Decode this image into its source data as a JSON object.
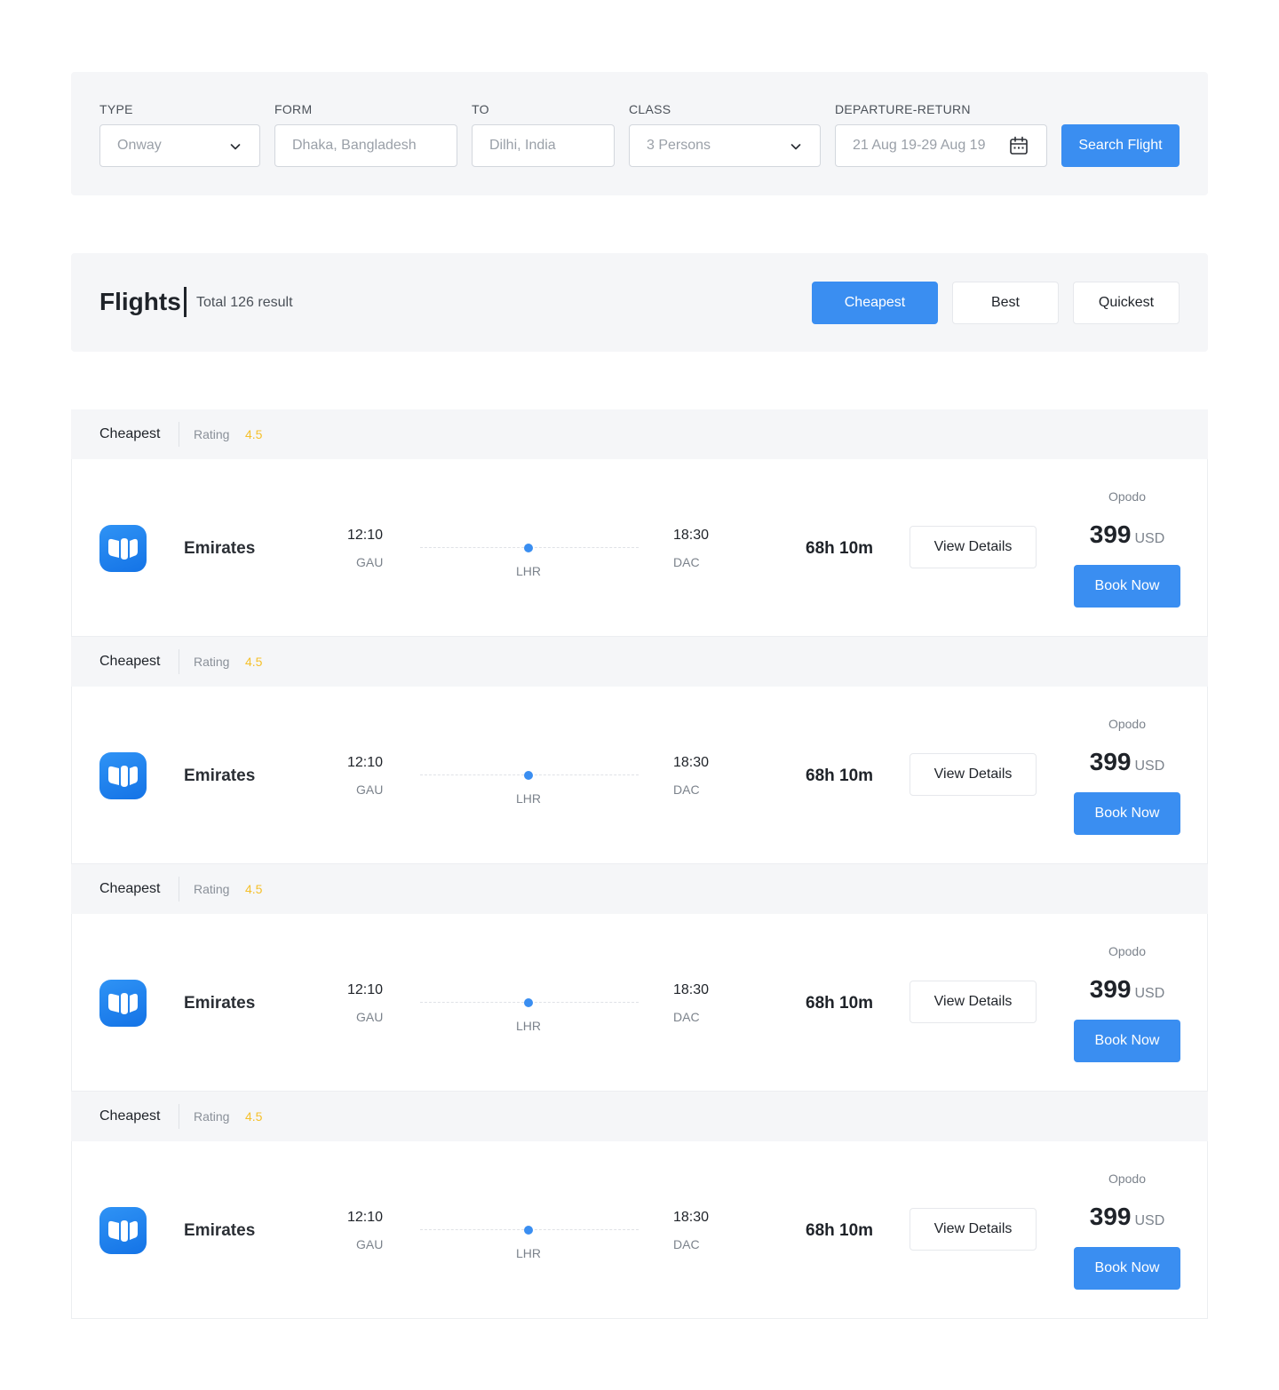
{
  "search": {
    "type": {
      "label": "TYPE",
      "value": "Onway"
    },
    "from": {
      "label": "FORM",
      "placeholder": "Dhaka, Bangladesh"
    },
    "to": {
      "label": "TO",
      "placeholder": "Dilhi, India"
    },
    "class": {
      "label": "CLASS",
      "value": "3 Persons"
    },
    "dates": {
      "label": "DEPARTURE-RETURN",
      "value": "21 Aug 19-29 Aug 19"
    },
    "button_label": "Search Flight"
  },
  "results": {
    "title": "Flights",
    "count_text": "Total 126 result",
    "sort_options": [
      {
        "label": "Cheapest",
        "active": true
      },
      {
        "label": "Best",
        "active": false
      },
      {
        "label": "Quickest",
        "active": false
      }
    ]
  },
  "flights": [
    {
      "tag": "Cheapest",
      "rating_label": "Rating",
      "rating": "4.5",
      "airline": "Emirates",
      "depart_time": "12:10",
      "depart_code": "GAU",
      "stop_code": "LHR",
      "arrive_time": "18:30",
      "arrive_code": "DAC",
      "duration": "68h 10m",
      "details_label": "View Details",
      "provider": "Opodo",
      "price": "399",
      "currency": "USD",
      "book_label": "Book Now"
    },
    {
      "tag": "Cheapest",
      "rating_label": "Rating",
      "rating": "4.5",
      "airline": "Emirates",
      "depart_time": "12:10",
      "depart_code": "GAU",
      "stop_code": "LHR",
      "arrive_time": "18:30",
      "arrive_code": "DAC",
      "duration": "68h 10m",
      "details_label": "View Details",
      "provider": "Opodo",
      "price": "399",
      "currency": "USD",
      "book_label": "Book Now"
    },
    {
      "tag": "Cheapest",
      "rating_label": "Rating",
      "rating": "4.5",
      "airline": "Emirates",
      "depart_time": "12:10",
      "depart_code": "GAU",
      "stop_code": "LHR",
      "arrive_time": "18:30",
      "arrive_code": "DAC",
      "duration": "68h 10m",
      "details_label": "View Details",
      "provider": "Opodo",
      "price": "399",
      "currency": "USD",
      "book_label": "Book Now"
    },
    {
      "tag": "Cheapest",
      "rating_label": "Rating",
      "rating": "4.5",
      "airline": "Emirates",
      "depart_time": "12:10",
      "depart_code": "GAU",
      "stop_code": "LHR",
      "arrive_time": "18:30",
      "arrive_code": "DAC",
      "duration": "68h 10m",
      "details_label": "View Details",
      "provider": "Opodo",
      "price": "399",
      "currency": "USD",
      "book_label": "Book Now"
    }
  ],
  "icons": {
    "dropdown": "chevron-down-icon",
    "calendar": "calendar-icon",
    "airline_logo": "airline-logo-icon"
  },
  "colors": {
    "accent": "#3a8ef1",
    "rating": "#f5c02b",
    "panel_bg": "#f5f6f8"
  }
}
